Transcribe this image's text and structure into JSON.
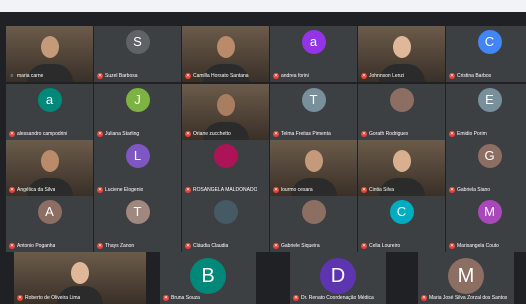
{
  "participants": [
    {
      "name": "maria carne",
      "initial": "",
      "mic_on": true,
      "video": true,
      "color": "#5f6368"
    },
    {
      "name": "Suzel Barbosa",
      "initial": "S",
      "mic_on": false,
      "video": false,
      "color": "#5f6368"
    },
    {
      "name": "Camilla Horsato Santana",
      "initial": "",
      "mic_on": false,
      "video": true,
      "color": "#5f6368"
    },
    {
      "name": "andrea forini",
      "initial": "a",
      "mic_on": false,
      "video": false,
      "color": "#9334e6"
    },
    {
      "name": "Johnnson Lenzi",
      "initial": "",
      "mic_on": false,
      "video": true,
      "color": "#5f6368"
    },
    {
      "name": "Cristina Barbos",
      "initial": "C",
      "mic_on": false,
      "video": false,
      "color": "#4285f4"
    },
    {
      "name": "alessandro campodrini",
      "initial": "a",
      "mic_on": false,
      "video": false,
      "color": "#00897b"
    },
    {
      "name": "Juliana Starling",
      "initial": "J",
      "mic_on": false,
      "video": false,
      "color": "#7cb342"
    },
    {
      "name": "Oriane zucchetto",
      "initial": "",
      "mic_on": false,
      "video": true,
      "color": "#5f6368"
    },
    {
      "name": "Telma Freitas Pimenta",
      "initial": "T",
      "mic_on": false,
      "video": false,
      "color": "#78909c"
    },
    {
      "name": "Gorath Rodrigues",
      "initial": "",
      "mic_on": false,
      "video": false,
      "color": "#8d6e63"
    },
    {
      "name": "Emidio Porim",
      "initial": "E",
      "mic_on": false,
      "video": false,
      "color": "#78909c"
    },
    {
      "name": "Angélica da Silva",
      "initial": "",
      "mic_on": false,
      "video": true,
      "color": "#5f6368"
    },
    {
      "name": "Luciene Elogenio",
      "initial": "L",
      "mic_on": false,
      "video": false,
      "color": "#7e57c2"
    },
    {
      "name": "ROSANGELA MALDONADO",
      "initial": "",
      "mic_on": false,
      "video": false,
      "color": "#ad1457"
    },
    {
      "name": "lourmo cesara",
      "initial": "",
      "mic_on": false,
      "video": true,
      "color": "#5f6368"
    },
    {
      "name": "Cintia Silva",
      "initial": "",
      "mic_on": false,
      "video": true,
      "color": "#5f6368"
    },
    {
      "name": "Gabriela Siano",
      "initial": "G",
      "mic_on": false,
      "video": false,
      "color": "#8d6e63"
    },
    {
      "name": "Antonio Poganha",
      "initial": "A",
      "mic_on": false,
      "video": false,
      "color": "#8d6e63"
    },
    {
      "name": "Thays Zanon",
      "initial": "T",
      "mic_on": false,
      "video": false,
      "color": "#a1887f"
    },
    {
      "name": "Cláudia Claudia",
      "initial": "",
      "mic_on": false,
      "video": false,
      "color": "#455a64"
    },
    {
      "name": "Gabriele Siqueira",
      "initial": "",
      "mic_on": false,
      "video": false,
      "color": "#8d6e63"
    },
    {
      "name": "Celia Loureiro",
      "initial": "C",
      "mic_on": false,
      "video": false,
      "color": "#00acc1"
    },
    {
      "name": "Marisangela Couto",
      "initial": "M",
      "mic_on": false,
      "video": false,
      "color": "#ab47bc"
    },
    {
      "name": "Roberto de Oliveira Lima",
      "initial": "",
      "mic_on": false,
      "video": true,
      "color": "#5f6368"
    },
    {
      "name": "Bruna Souza",
      "initial": "B",
      "mic_on": false,
      "video": false,
      "color": "#00897b"
    },
    {
      "name": "Dr. Renato Coordenação Médica",
      "initial": "D",
      "mic_on": false,
      "video": false,
      "color": "#5e35b1"
    },
    {
      "name": "Maria José Silva Zorzal dos Santos",
      "initial": "M",
      "mic_on": false,
      "video": false,
      "color": "#8d6e63"
    }
  ]
}
